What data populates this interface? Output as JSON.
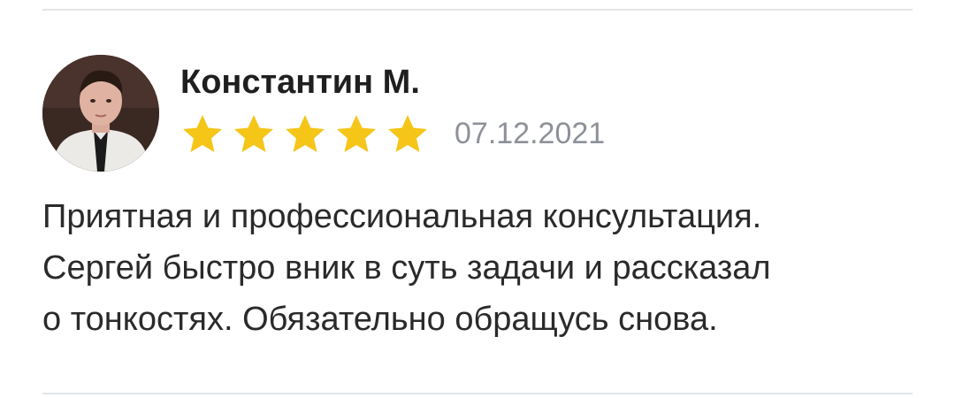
{
  "review": {
    "author": "Константин М.",
    "rating": 5,
    "rating_max": 5,
    "date": "07.12.2021",
    "text_lines": [
      "Приятная и профессиональная консультация.",
      "Сергей быстро вник в суть задачи и рассказал",
      "о тонкостях. Обязательно обращусь снова."
    ]
  },
  "colors": {
    "star": "#f5c518",
    "date": "#8d9198",
    "divider": "#e3e5e8",
    "text": "#2a2a2a"
  }
}
